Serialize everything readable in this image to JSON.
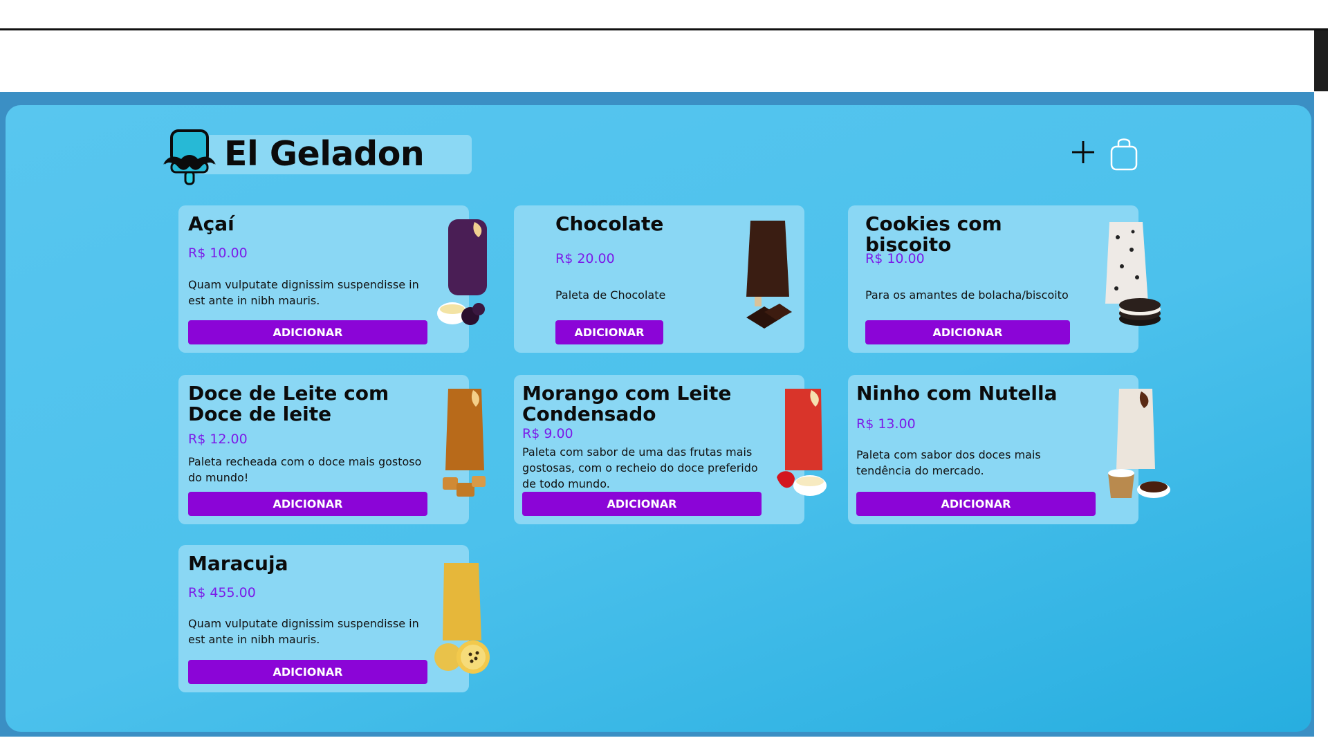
{
  "brand": {
    "name": "El Geladon",
    "logo_icon": "mustache-popsicle-icon"
  },
  "header": {
    "add_icon": "plus-icon",
    "cart_icon": "shopping-bag-icon"
  },
  "products": [
    {
      "name": "Açaí",
      "price": "R$ 10.00",
      "description": "Quam vulputate dignissim suspendisse in est ante in nibh mauris.",
      "button": "ADICIONAR",
      "image_icon": "acai-popsicle-icon",
      "colors": {
        "popsicle": "#4a1e55"
      }
    },
    {
      "name": "Chocolate",
      "price": "R$ 20.00",
      "description": "Paleta de Chocolate",
      "button": "ADICIONAR",
      "image_icon": "chocolate-popsicle-icon",
      "colors": {
        "popsicle": "#3a1d12"
      }
    },
    {
      "name": "Cookies com biscoito",
      "price": "R$ 10.00",
      "description": "Para os amantes de bolacha/biscoito",
      "button": "ADICIONAR",
      "image_icon": "cookies-popsicle-icon",
      "colors": {
        "popsicle": "#eeeae6"
      }
    },
    {
      "name": "Doce de Leite com Doce de leite",
      "price": "R$ 12.00",
      "description": "Paleta recheada com o doce mais gostoso do mundo!",
      "button": "ADICIONAR",
      "image_icon": "doce-de-leite-popsicle-icon",
      "colors": {
        "popsicle": "#b86a1a"
      }
    },
    {
      "name": "Morango com Leite Condensado",
      "price": "R$ 9.00",
      "description": "Paleta com sabor de uma das frutas mais gostosas, com o recheio do doce preferido de todo mundo.",
      "button": "ADICIONAR",
      "image_icon": "strawberry-popsicle-icon",
      "colors": {
        "popsicle": "#d9342a"
      }
    },
    {
      "name": "Ninho com Nutella",
      "price": "R$ 13.00",
      "description": "Paleta com sabor dos doces mais tendência do mercado.",
      "button": "ADICIONAR",
      "image_icon": "ninho-nutella-popsicle-icon",
      "colors": {
        "popsicle": "#ece5dc"
      }
    },
    {
      "name": "Maracuja",
      "price": "R$ 455.00",
      "description": "Quam vulputate dignissim suspendisse in est ante in nibh mauris.",
      "button": "ADICIONAR",
      "image_icon": "passion-fruit-popsicle-icon",
      "colors": {
        "popsicle": "#e6b73a"
      }
    }
  ],
  "theme": {
    "panel_blue": "#4cc1ec",
    "card_blue": "#8ad7f4",
    "button_purple": "#8b05d7",
    "price_purple": "#7b1be8"
  }
}
